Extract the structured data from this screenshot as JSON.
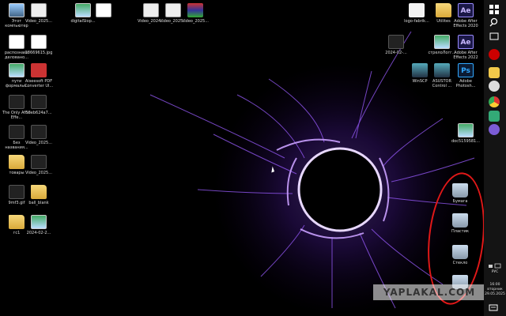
{
  "desktop": {
    "icons_left": [
      {
        "label": "Этот компьютер",
        "type": "pc"
      },
      {
        "label": "Video_2025...",
        "type": "vid"
      },
      {
        "label": "digitalSlop...",
        "type": "img"
      },
      {
        "label": "",
        "type": "doc"
      },
      {
        "label": "Video_2024...",
        "type": "vid"
      },
      {
        "label": "Video_2025...",
        "type": "vid"
      },
      {
        "label": "Video_2025...",
        "type": "rar"
      },
      {
        "label": "распознава деловано...",
        "type": "doc"
      },
      {
        "label": "18669615.jpg",
        "type": "doc"
      },
      {
        "label": "пути формальн.",
        "type": "img"
      },
      {
        "label": "Aiseesoft PDF Converter Ul...",
        "type": "pdf"
      },
      {
        "label": "The Only After Effe...",
        "type": "dark"
      },
      {
        "label": "56eb624a7...",
        "type": "dark"
      },
      {
        "label": "Без названия...",
        "type": "dark"
      },
      {
        "label": "Video_2025...",
        "type": "dark"
      },
      {
        "label": "товары",
        "type": "folder"
      },
      {
        "label": "Video_2025...",
        "type": "dark"
      },
      {
        "label": "9mf3.gif",
        "type": "dark"
      },
      {
        "label": "ball_blank",
        "type": "folder"
      },
      {
        "label": "гс1",
        "type": "folder"
      },
      {
        "label": "2024-02-2...",
        "type": "img"
      }
    ],
    "icons_right": [
      {
        "label": "logo-fabrik...",
        "type": "logo"
      },
      {
        "label": "Utilites",
        "type": "folder"
      },
      {
        "label": "Adobe After Effects 2020",
        "type": "ae",
        "glyph": "Ae"
      },
      {
        "label": "2024-02-...",
        "type": "dark"
      },
      {
        "label": "стрелоЛогг...",
        "type": "img"
      },
      {
        "label": "Adobe After Effects 2022",
        "type": "ae",
        "glyph": "Ae"
      },
      {
        "label": "WinSCP",
        "type": "net"
      },
      {
        "label": "ASUSTOR Control ...",
        "type": "net"
      },
      {
        "label": "Adobe Photosh...",
        "type": "ps",
        "glyph": "Ps"
      },
      {
        "label": "doc5159581...",
        "type": "img"
      }
    ],
    "recycle_bins": [
      {
        "label": "Бумага"
      },
      {
        "label": "Пластик"
      },
      {
        "label": "Стекло"
      },
      {
        "label": ""
      }
    ]
  },
  "taskbar": {
    "keyboard_lang": "РУС",
    "clock_time": "16:00",
    "clock_day": "вторник",
    "clock_date": "29.05.2025"
  },
  "watermark": {
    "text": "YAPLAKAL.COM"
  },
  "colors": {
    "accent": "#8a3cff",
    "circle": "#e01818",
    "taskbar": "#141414"
  }
}
